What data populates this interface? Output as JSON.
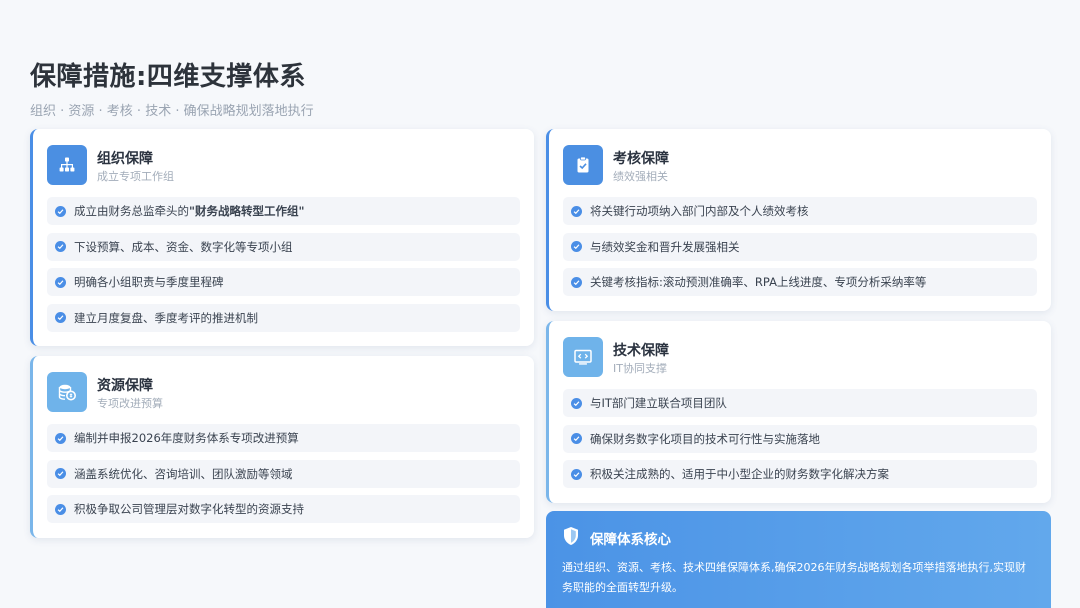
{
  "title": "保障措施:四维支撑体系",
  "subtitle": "组织 · 资源 · 考核 · 技术 · 确保战略规划落地执行",
  "cards": {
    "org": {
      "title": "组织保障",
      "subtitle": "成立专项工作组",
      "icon": "org-chart-icon",
      "items": [
        {
          "prefix": "成立由财务总监牵头的",
          "bold": "\"财务战略转型工作组\""
        },
        {
          "prefix": "下设预算、成本、资金、数字化等专项小组"
        },
        {
          "prefix": "明确各小组职责与季度里程碑"
        },
        {
          "prefix": "建立月度复盘、季度考评的推进机制"
        }
      ]
    },
    "resource": {
      "title": "资源保障",
      "subtitle": "专项改进预算",
      "icon": "coins-icon",
      "items": [
        "编制并申报2026年度财务体系专项改进预算",
        "涵盖系统优化、咨询培训、团队激励等领域",
        "积极争取公司管理层对数字化转型的资源支持"
      ]
    },
    "assessment": {
      "title": "考核保障",
      "subtitle": "绩效强相关",
      "icon": "clipboard-check-icon",
      "items": [
        "将关键行动项纳入部门内部及个人绩效考核",
        "与绩效奖金和晋升发展强相关",
        "关键考核指标:滚动预测准确率、RPA上线进度、专项分析采纳率等"
      ]
    },
    "tech": {
      "title": "技术保障",
      "subtitle": "IT协同支撑",
      "icon": "code-window-icon",
      "items": [
        "与IT部门建立联合项目团队",
        "确保财务数字化项目的技术可行性与实施落地",
        "积极关注成熟的、适用于中小型企业的财务数字化解决方案"
      ]
    }
  },
  "core": {
    "title": "保障体系核心",
    "icon": "shield-icon",
    "text": "通过组织、资源、考核、技术四维保障体系,确保2026年财务战略规划各项举措落地执行,实现财务职能的全面转型升级。"
  },
  "colors": {
    "accent": "#4a8ee6",
    "accent_light": "#6fb3ea",
    "title": "#2d333b",
    "muted": "#9aa4b2"
  }
}
